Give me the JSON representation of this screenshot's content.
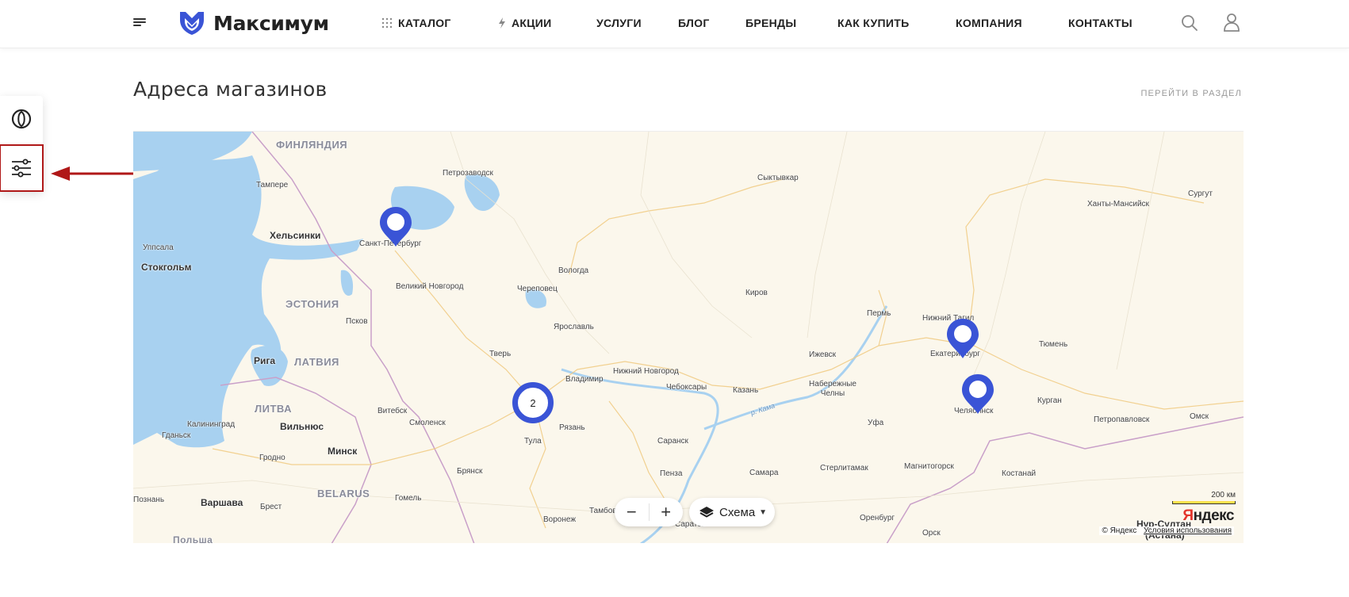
{
  "header": {
    "brand": "Максимум",
    "nav": [
      {
        "label": "КАТАЛОГ"
      },
      {
        "label": "АКЦИИ"
      },
      {
        "label": "УСЛУГИ"
      },
      {
        "label": "БЛОГ"
      },
      {
        "label": "БРЕНДЫ"
      },
      {
        "label": "КАК КУПИТЬ"
      },
      {
        "label": "КОМПАНИЯ"
      },
      {
        "label": "КОНТАКТЫ"
      }
    ],
    "accent_color": "#3a54d6"
  },
  "page": {
    "title": "Адреса магазинов",
    "section_link": "ПЕРЕЙТИ В РАЗДЕЛ"
  },
  "map": {
    "countries": [
      "ФИНЛЯНДИЯ",
      "ЭСТОНИЯ",
      "ЛАТВИЯ",
      "ЛИТВА",
      "BELARUS"
    ],
    "capitals": [
      "Хельсинки",
      "Стокгольм",
      "Рига",
      "Вильнюс",
      "Минск",
      "Варшава"
    ],
    "cities": [
      "Тампере",
      "Уппсала",
      "Петрозаводск",
      "Санкт-Петербург",
      "Сыктывкар",
      "Сургут",
      "Ханты-Мансийск",
      "Вологда",
      "Великий Новгород",
      "Череповец",
      "Псков",
      "Ярославль",
      "Киров",
      "Пермь",
      "Нижний Тагил",
      "Екатеринбург",
      "Тюмень",
      "Тверь",
      "Ижевск",
      "Владимир",
      "Нижний Новгород",
      "Чебоксары",
      "Казань",
      "Набережные Челны",
      "Калининград",
      "Витебск",
      "Смоленск",
      "Гданьск",
      "Гродно",
      "Рязань",
      "Тула",
      "Саранск",
      "Уфа",
      "Курган",
      "Челябинск",
      "Петропавловск",
      "Омск",
      "Брянск",
      "Стерлитамак",
      "Магнитогорск",
      "Костанай",
      "Пенза",
      "Самара",
      "Тамбов",
      "Брест",
      "Гомель",
      "Воронеж",
      "Саратов",
      "Оренбург",
      "Орск",
      "Познань",
      "Нур-Султан",
      "(Астана)",
      "Польша"
    ],
    "river": "р. Кама",
    "cluster_count": "2",
    "zoom_out": "−",
    "zoom_in": "+",
    "layer_label": "Схема",
    "scale_label": "200 км",
    "provider": "Яндекс",
    "copyright": "© Яндекс",
    "terms_link": "Условия использования"
  }
}
